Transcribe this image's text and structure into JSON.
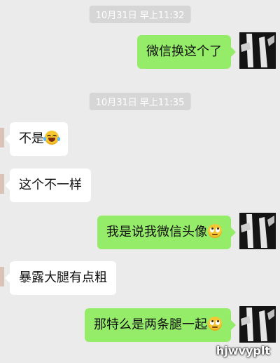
{
  "timestamps": [
    "10月31日 早上11:32",
    "10月31日 早上11:35"
  ],
  "messages": [
    {
      "side": "out",
      "text": "微信换这个了",
      "emoji": ""
    },
    {
      "side": "in",
      "text": "不是",
      "emoji": "laughing-tears-emoji"
    },
    {
      "side": "in",
      "text": "这个不一样",
      "emoji": ""
    },
    {
      "side": "out",
      "text": "我是说我微信头像",
      "emoji": "eye-roll-emoji"
    },
    {
      "side": "in",
      "text": "暴露大腿有点粗",
      "emoji": ""
    },
    {
      "side": "out",
      "text": "那特么是两条腿一起",
      "emoji": "eye-roll-emoji"
    }
  ],
  "watermark": "hjwvyplt",
  "colors": {
    "background": "#ebebeb",
    "outgoing_bubble": "#95ec69",
    "incoming_bubble": "#ffffff",
    "timestamp_bg": "#d6d6d6"
  }
}
